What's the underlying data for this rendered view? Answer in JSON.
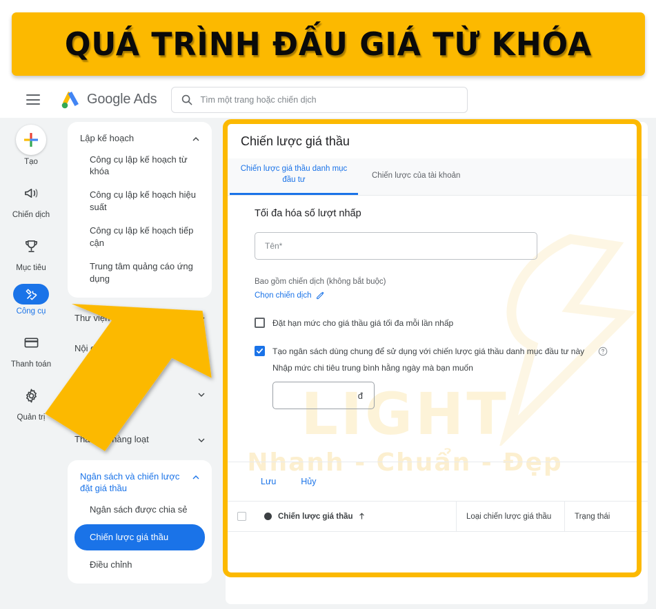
{
  "banner": {
    "title": "QUÁ TRÌNH ĐẤU GIÁ TỪ KHÓA",
    "bg_color": "#fcb900"
  },
  "topbar": {
    "menu_icon": "hamburger-icon",
    "brand_google": "Google",
    "brand_ads": "Ads",
    "search": {
      "icon": "search-icon",
      "placeholder": "Tìm một trang hoặc chiến dịch",
      "value": ""
    }
  },
  "rail": {
    "items": [
      {
        "label": "Tạo",
        "icon": "plus-icon",
        "active": false
      },
      {
        "label": "Chiến dịch",
        "icon": "megaphone-icon",
        "active": false
      },
      {
        "label": "Mục tiêu",
        "icon": "trophy-icon",
        "active": false
      },
      {
        "label": "Công cụ",
        "icon": "tools-icon",
        "active": true
      },
      {
        "label": "Thanh toán",
        "icon": "credit-card-icon",
        "active": false
      },
      {
        "label": "Quản trị",
        "icon": "gear-icon",
        "active": false
      }
    ]
  },
  "nav": {
    "group_plan": {
      "title": "Lập kế hoạch",
      "chevron": "chevron-up-icon",
      "items": [
        "Công cụ lập kế hoạch từ khóa",
        "Công cụ lập kế hoạch hiệu suất",
        "Công cụ lập kế hoạch tiếp cận",
        "Trung tâm quảng cáo ứng dụng"
      ]
    },
    "flat_items": [
      {
        "title": "Thư viện chia sẻ",
        "chevron": "chevron-down-icon"
      },
      {
        "title": "Nội dung nh",
        "chevron": "chevron-down-icon"
      },
      {
        "title": "",
        "chevron": "chevron-down-icon"
      },
      {
        "title": "Thao tác hàng loạt",
        "chevron": "chevron-down-icon"
      }
    ],
    "group_budget": {
      "title": "Ngân sách và chiến lược đặt giá thầu",
      "chevron": "chevron-up-icon",
      "items": [
        {
          "label": "Ngân sách được chia sẻ",
          "selected": false
        },
        {
          "label": "Chiến lược giá thầu",
          "selected": true
        },
        {
          "label": "Điều chỉnh",
          "selected": false
        }
      ]
    }
  },
  "panel": {
    "title": "Chiến lược giá thầu",
    "tabs": [
      {
        "label": "Chiến lược giá thầu danh mục đầu tư",
        "active": true
      },
      {
        "label": "Chiến lược của tài khoản",
        "active": false
      }
    ],
    "form": {
      "heading": "Tối đa hóa số lượt nhấp",
      "name_placeholder": "Tên*",
      "name_value": "",
      "include_note": "Bao gồm chiến dịch (không bắt buộc)",
      "pick_campaign": "Chọn chiến dịch",
      "pencil_icon": "pencil-icon",
      "checkbox_limit": {
        "label": "Đặt hạn mức cho giá thầu giá tối đa mỗi lần nhấp",
        "checked": false
      },
      "checkbox_shared_budget": {
        "label": "Tạo ngân sách dùng chung để sử dụng với chiến lược giá thầu danh mục đầu tư này",
        "checked": true,
        "help_icon": "help-icon"
      },
      "daily_spend_note": "Nhập mức chi tiêu trung bình hằng ngày mà bạn muốn",
      "amount_value": "",
      "currency_symbol": "đ"
    },
    "actions": {
      "save": "Lưu",
      "cancel": "Hủy"
    },
    "table": {
      "headers": {
        "select_all": "select-all-checkbox",
        "status_dot": "status-dot",
        "name": "Chiến lược giá thầu",
        "sort_icon": "arrow-up-icon",
        "type": "Loại chiến lược giá thầu",
        "status": "Trạng thái"
      },
      "rows": []
    }
  },
  "watermark": {
    "big": "LIGHT",
    "tagline": "Nhanh - Chuẩn - Đẹp"
  },
  "annotation": {
    "highlight_color": "#fcb900",
    "arrow": "up-right-arrow-pointer"
  },
  "colors": {
    "accent_blue": "#1a73e8",
    "yellow": "#fcb900",
    "bg_gray": "#f1f3f4"
  }
}
